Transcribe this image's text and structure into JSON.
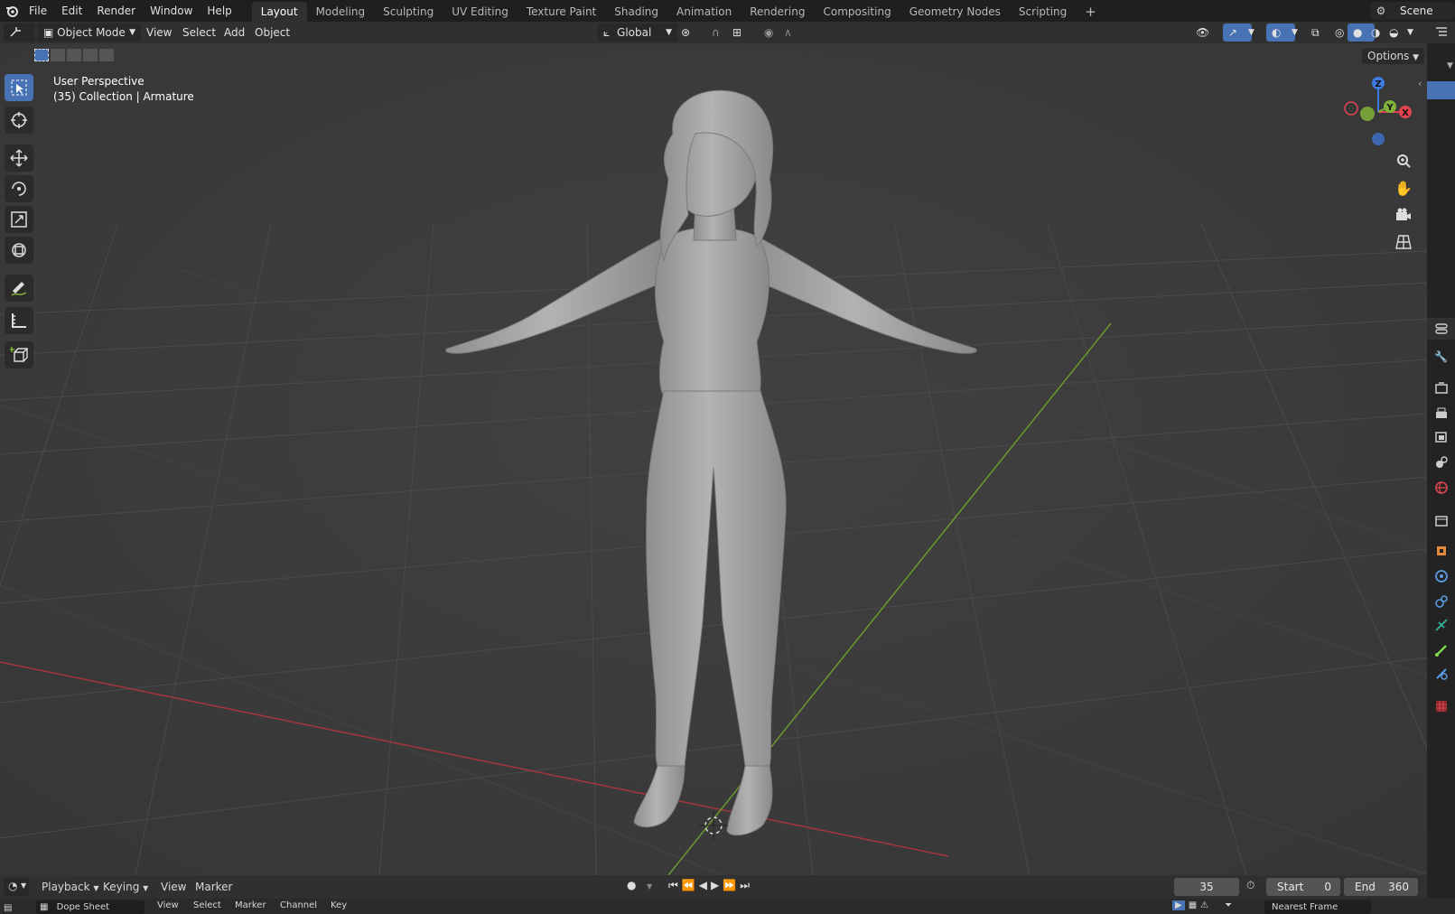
{
  "top_menu": {
    "file": "File",
    "edit": "Edit",
    "render": "Render",
    "window": "Window",
    "help": "Help"
  },
  "workspaces": [
    "Layout",
    "Modeling",
    "Sculpting",
    "UV Editing",
    "Texture Paint",
    "Shading",
    "Animation",
    "Rendering",
    "Compositing",
    "Geometry Nodes",
    "Scripting"
  ],
  "add_workspace": "+",
  "scene_name": "Scene",
  "header": {
    "mode": "Object Mode",
    "view": "View",
    "select": "Select",
    "add": "Add",
    "object": "Object",
    "orientation": "Global",
    "options": "Options"
  },
  "viewport": {
    "perspective": "User Perspective",
    "collection": "(35) Collection | Armature"
  },
  "gizmo": {
    "z": "Z",
    "y": "Y",
    "x": "X"
  },
  "timeline": {
    "playback": "Playback",
    "keying": "Keying",
    "view": "View",
    "marker": "Marker",
    "current_frame": "35",
    "start_label": "Start",
    "start_value": "0",
    "end_label": "End",
    "end_value": "360"
  },
  "dopesheet": {
    "mode": "Dope Sheet",
    "view": "View",
    "select": "Select",
    "marker": "Marker",
    "channel": "Channel",
    "key": "Key",
    "snapping": "Nearest Frame"
  },
  "colors": {
    "accent": "#4772b3",
    "x_axis": "#e0454f",
    "y_axis": "#7fb23a",
    "z_axis": "#3f7be0"
  }
}
